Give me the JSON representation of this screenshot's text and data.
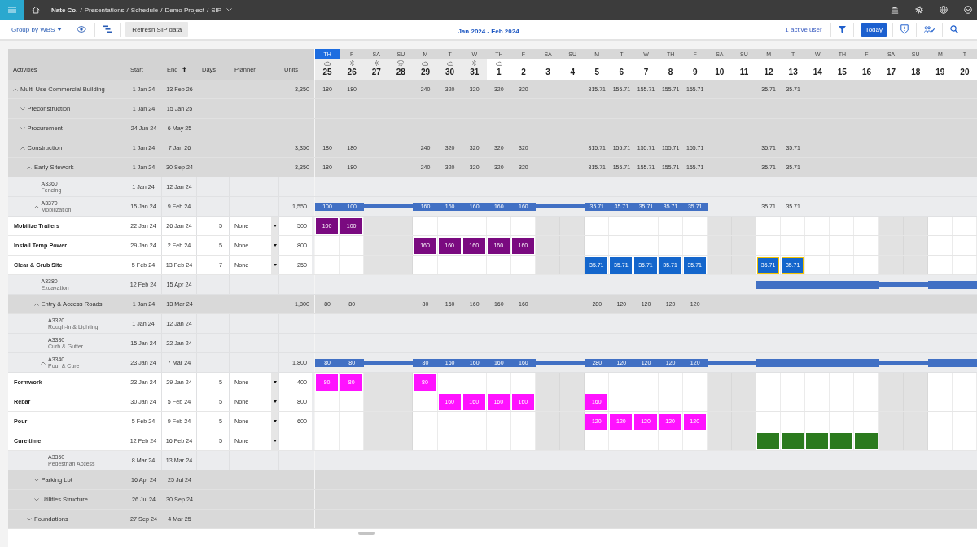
{
  "top_bar": {
    "breadcrumb": [
      "Nate Co.",
      "Presentations",
      "Schedule",
      "Demo Project",
      "SIP"
    ],
    "separator": "/"
  },
  "toolbar": {
    "group_by": "Group by WBS",
    "refresh_button": "Refresh SIP data",
    "date_range": "Jan 2024 - Feb 2024",
    "active_users": "1 active user",
    "today_button": "Today"
  },
  "table": {
    "columns": [
      {
        "label": "Activities",
        "sorted": false
      },
      {
        "label": "Start",
        "sorted": false
      },
      {
        "label": "End",
        "sorted": true
      },
      {
        "label": "Days",
        "sorted": false
      },
      {
        "label": "Planner",
        "sorted": false
      },
      {
        "label": "Units",
        "sorted": false
      }
    ]
  },
  "timeline": {
    "days": [
      {
        "weekday": "TH",
        "date": "25",
        "today": true,
        "weekend": false,
        "shaded": true,
        "weather": {
          "kind": "cloud"
        }
      },
      {
        "weekday": "F",
        "date": "26",
        "today": false,
        "weekend": false,
        "shaded": true,
        "weather": {
          "kind": "sun"
        }
      },
      {
        "weekday": "SA",
        "date": "27",
        "today": false,
        "weekend": true,
        "shaded": true,
        "weather": {
          "kind": "sun"
        }
      },
      {
        "weekday": "SU",
        "date": "28",
        "today": false,
        "weekend": true,
        "shaded": true,
        "weather": {
          "kind": "rain"
        }
      },
      {
        "weekday": "M",
        "date": "29",
        "today": false,
        "weekend": false,
        "shaded": true,
        "weather": {
          "kind": "cloud"
        }
      },
      {
        "weekday": "T",
        "date": "30",
        "today": false,
        "weekend": false,
        "shaded": true,
        "weather": {
          "kind": "cloud"
        }
      },
      {
        "weekday": "W",
        "date": "31",
        "today": false,
        "weekend": false,
        "shaded": true,
        "weather": {
          "kind": "sun"
        }
      },
      {
        "weekday": "TH",
        "date": "1",
        "today": false,
        "weekend": false,
        "shaded": false,
        "weather": {
          "kind": "cloud"
        }
      },
      {
        "weekday": "F",
        "date": "2",
        "today": false,
        "weekend": false,
        "shaded": false
      },
      {
        "weekday": "SA",
        "date": "3",
        "today": false,
        "weekend": true,
        "shaded": false
      },
      {
        "weekday": "SU",
        "date": "4",
        "today": false,
        "weekend": true,
        "shaded": false
      },
      {
        "weekday": "M",
        "date": "5",
        "today": false,
        "weekend": false,
        "shaded": false
      },
      {
        "weekday": "T",
        "date": "6",
        "today": false,
        "weekend": false,
        "shaded": false
      },
      {
        "weekday": "W",
        "date": "7",
        "today": false,
        "weekend": false,
        "shaded": false
      },
      {
        "weekday": "TH",
        "date": "8",
        "today": false,
        "weekend": false,
        "shaded": false
      },
      {
        "weekday": "F",
        "date": "9",
        "today": false,
        "weekend": false,
        "shaded": false
      },
      {
        "weekday": "SA",
        "date": "10",
        "today": false,
        "weekend": true,
        "shaded": false
      },
      {
        "weekday": "SU",
        "date": "11",
        "today": false,
        "weekend": true,
        "shaded": false
      },
      {
        "weekday": "M",
        "date": "12",
        "today": false,
        "weekend": false,
        "shaded": false
      },
      {
        "weekday": "T",
        "date": "13",
        "today": false,
        "weekend": false,
        "shaded": false
      },
      {
        "weekday": "W",
        "date": "14",
        "today": false,
        "weekend": false,
        "shaded": false
      },
      {
        "weekday": "TH",
        "date": "15",
        "today": false,
        "weekend": false,
        "shaded": false
      },
      {
        "weekday": "F",
        "date": "16",
        "today": false,
        "weekend": false,
        "shaded": false
      },
      {
        "weekday": "SA",
        "date": "17",
        "today": false,
        "weekend": true,
        "shaded": false
      },
      {
        "weekday": "SU",
        "date": "18",
        "today": false,
        "weekend": true,
        "shaded": false
      },
      {
        "weekday": "M",
        "date": "19",
        "today": false,
        "weekend": false,
        "shaded": false
      },
      {
        "weekday": "T",
        "date": "20",
        "today": false,
        "weekend": false,
        "shaded": false
      }
    ]
  },
  "rows": [
    {
      "kind": "wbs",
      "name": "Multi-Use Commercial Building",
      "start": "1 Jan 24",
      "end": "13 Feb 26",
      "units": "3,350",
      "expanded": true,
      "cells": [
        "180",
        "180",
        null,
        null,
        "240",
        "320",
        "320",
        "320",
        "320",
        null,
        null,
        "315.71",
        "155.71",
        "155.71",
        "155.71",
        "155.71",
        null,
        null,
        "35.71",
        "35.71",
        null,
        null,
        null,
        null,
        null,
        null,
        null
      ],
      "children": [
        {
          "kind": "wbs",
          "name": "Preconstruction",
          "start": "1 Jan 24",
          "end": "15 Jan 25",
          "expanded": false
        },
        {
          "kind": "wbs",
          "name": "Procurement",
          "start": "24 Jun 24",
          "end": "6 May 25",
          "expanded": false
        },
        {
          "kind": "wbs",
          "name": "Construction",
          "start": "1 Jan 24",
          "end": "7 Jan 26",
          "units": "3,350",
          "expanded": true,
          "cells": [
            "180",
            "180",
            null,
            null,
            "240",
            "320",
            "320",
            "320",
            "320",
            null,
            null,
            "315.71",
            "155.71",
            "155.71",
            "155.71",
            "155.71",
            null,
            null,
            "35.71",
            "35.71",
            null,
            null,
            null,
            null,
            null,
            null,
            null
          ],
          "children": [
            {
              "kind": "wbs",
              "name": "Early Sitework",
              "start": "1 Jan 24",
              "end": "30 Sep 24",
              "units": "3,350",
              "expanded": true,
              "cells": [
                "180",
                "180",
                null,
                null,
                "240",
                "320",
                "320",
                "320",
                "320",
                null,
                null,
                "315.71",
                "155.71",
                "155.71",
                "155.71",
                "155.71",
                null,
                null,
                "35.71",
                "35.71",
                null,
                null,
                null,
                null,
                null,
                null,
                null
              ],
              "children": [
                {
                  "kind": "activity",
                  "id": "A3360",
                  "name": "Fencing",
                  "start": "1 Jan 24",
                  "end": "12 Jan 24"
                },
                {
                  "kind": "activity",
                  "id": "A3370",
                  "name": "Mobilization",
                  "start": "15 Jan 24",
                  "end": "9 Feb 24",
                  "units": "1,550",
                  "expanded": true,
                  "cells": [
                    {
                      "kind": "bar",
                      "value": "100"
                    },
                    {
                      "kind": "bar",
                      "value": "100"
                    },
                    {
                      "kind": "bar"
                    },
                    {
                      "kind": "bar"
                    },
                    {
                      "kind": "bar",
                      "value": "160"
                    },
                    {
                      "kind": "bar",
                      "value": "160"
                    },
                    {
                      "kind": "bar",
                      "value": "160"
                    },
                    {
                      "kind": "bar",
                      "value": "160"
                    },
                    {
                      "kind": "bar",
                      "value": "160"
                    },
                    {
                      "kind": "bar"
                    },
                    {
                      "kind": "bar"
                    },
                    {
                      "kind": "bar",
                      "value": "35.71"
                    },
                    {
                      "kind": "bar",
                      "value": "35.71"
                    },
                    {
                      "kind": "bar",
                      "value": "35.71"
                    },
                    {
                      "kind": "bar",
                      "value": "35.71"
                    },
                    {
                      "kind": "bar",
                      "value": "35.71"
                    },
                    null,
                    null,
                    "35.71",
                    "35.71",
                    null,
                    null,
                    null,
                    null,
                    null,
                    null,
                    null
                  ],
                  "children": [
                    {
                      "kind": "task",
                      "name": "Mobilize Trailers",
                      "start": "22 Jan 24",
                      "end": "26 Jan 24",
                      "days": "5",
                      "planner": "None",
                      "units": "500",
                      "color": "#7a0a80",
                      "cells": [
                        {
                          "kind": "block",
                          "value": "100",
                          "highlighted": false
                        },
                        {
                          "kind": "block",
                          "value": "100",
                          "highlighted": false
                        },
                        null,
                        null,
                        null,
                        null,
                        null,
                        null,
                        null,
                        null,
                        null,
                        null,
                        null,
                        null,
                        null,
                        null,
                        null,
                        null,
                        null,
                        null,
                        null,
                        null,
                        null,
                        null,
                        null,
                        null,
                        null
                      ]
                    },
                    {
                      "kind": "task",
                      "name": "Install Temp Power",
                      "start": "29 Jan 24",
                      "end": "2 Feb 24",
                      "days": "5",
                      "planner": "None",
                      "units": "800",
                      "color": "#7a0a80",
                      "cells": [
                        null,
                        null,
                        null,
                        null,
                        {
                          "kind": "block",
                          "value": "160",
                          "highlighted": false
                        },
                        {
                          "kind": "block",
                          "value": "160",
                          "highlighted": false
                        },
                        {
                          "kind": "block",
                          "value": "160",
                          "highlighted": false
                        },
                        {
                          "kind": "block",
                          "value": "160",
                          "highlighted": false
                        },
                        {
                          "kind": "block",
                          "value": "160",
                          "highlighted": false
                        },
                        null,
                        null,
                        null,
                        null,
                        null,
                        null,
                        null,
                        null,
                        null,
                        null,
                        null,
                        null,
                        null,
                        null,
                        null,
                        null,
                        null,
                        null
                      ]
                    },
                    {
                      "kind": "task",
                      "name": "Clear & Grub Site",
                      "start": "5 Feb 24",
                      "end": "13 Feb 24",
                      "days": "7",
                      "planner": "None",
                      "units": "250",
                      "color": "#1466cc",
                      "cells": [
                        null,
                        null,
                        null,
                        null,
                        null,
                        null,
                        null,
                        null,
                        null,
                        null,
                        null,
                        {
                          "kind": "block",
                          "value": "35.71",
                          "highlighted": false
                        },
                        {
                          "kind": "block",
                          "value": "35.71",
                          "highlighted": false
                        },
                        {
                          "kind": "block",
                          "value": "35.71",
                          "highlighted": false
                        },
                        {
                          "kind": "block",
                          "value": "35.71",
                          "highlighted": false
                        },
                        {
                          "kind": "block",
                          "value": "35.71",
                          "highlighted": false
                        },
                        null,
                        null,
                        {
                          "kind": "block",
                          "value": "35.71",
                          "highlighted": true
                        },
                        {
                          "kind": "block",
                          "value": "35.71",
                          "highlighted": true
                        },
                        null,
                        null,
                        null,
                        null,
                        null,
                        null,
                        null
                      ]
                    }
                  ]
                },
                {
                  "kind": "activity",
                  "id": "A3380",
                  "name": "Excavation",
                  "start": "12 Feb 24",
                  "end": "15 Apr 24",
                  "cells": [
                    null,
                    null,
                    null,
                    null,
                    null,
                    null,
                    null,
                    null,
                    null,
                    null,
                    null,
                    null,
                    null,
                    null,
                    null,
                    null,
                    null,
                    null,
                    {
                      "kind": "bar"
                    },
                    {
                      "kind": "bar"
                    },
                    {
                      "kind": "bar"
                    },
                    {
                      "kind": "bar"
                    },
                    {
                      "kind": "bar"
                    },
                    {
                      "kind": "bar"
                    },
                    {
                      "kind": "bar"
                    },
                    {
                      "kind": "bar"
                    },
                    {
                      "kind": "bar"
                    }
                  ]
                },
                {
                  "kind": "wbs",
                  "name": "Entry & Access Roads",
                  "start": "1 Jan 24",
                  "end": "13 Mar 24",
                  "units": "1,800",
                  "expanded": true,
                  "cells": [
                    "80",
                    "80",
                    null,
                    null,
                    "80",
                    "160",
                    "160",
                    "160",
                    "160",
                    null,
                    null,
                    "280",
                    "120",
                    "120",
                    "120",
                    "120",
                    null,
                    null,
                    null,
                    null,
                    null,
                    null,
                    null,
                    null,
                    null,
                    null,
                    null
                  ],
                  "children": [
                    {
                      "kind": "activity",
                      "id": "A3320",
                      "name": "Rough-in & Lighting",
                      "start": "1 Jan 24",
                      "end": "12 Jan 24"
                    },
                    {
                      "kind": "activity",
                      "id": "A3330",
                      "name": "Curb & Gutter",
                      "start": "15 Jan 24",
                      "end": "22 Jan 24"
                    },
                    {
                      "kind": "activity",
                      "id": "A3340",
                      "name": "Pour & Cure",
                      "start": "23 Jan 24",
                      "end": "7 Mar 24",
                      "units": "1,800",
                      "expanded": true,
                      "cells": [
                        {
                          "kind": "bar",
                          "value": "80"
                        },
                        {
                          "kind": "bar",
                          "value": "80"
                        },
                        {
                          "kind": "bar"
                        },
                        {
                          "kind": "bar"
                        },
                        {
                          "kind": "bar",
                          "value": "80"
                        },
                        {
                          "kind": "bar",
                          "value": "160"
                        },
                        {
                          "kind": "bar",
                          "value": "160"
                        },
                        {
                          "kind": "bar",
                          "value": "160"
                        },
                        {
                          "kind": "bar",
                          "value": "160"
                        },
                        {
                          "kind": "bar"
                        },
                        {
                          "kind": "bar"
                        },
                        {
                          "kind": "bar",
                          "value": "280"
                        },
                        {
                          "kind": "bar",
                          "value": "120"
                        },
                        {
                          "kind": "bar",
                          "value": "120"
                        },
                        {
                          "kind": "bar",
                          "value": "120"
                        },
                        {
                          "kind": "bar",
                          "value": "120"
                        },
                        {
                          "kind": "bar"
                        },
                        {
                          "kind": "bar"
                        },
                        {
                          "kind": "bar"
                        },
                        {
                          "kind": "bar"
                        },
                        {
                          "kind": "bar"
                        },
                        {
                          "kind": "bar"
                        },
                        {
                          "kind": "bar"
                        },
                        {
                          "kind": "bar"
                        },
                        {
                          "kind": "bar"
                        },
                        {
                          "kind": "bar"
                        },
                        {
                          "kind": "bar"
                        }
                      ],
                      "children": [
                        {
                          "kind": "task",
                          "name": "Formwork",
                          "start": "23 Jan 24",
                          "end": "29 Jan 24",
                          "days": "5",
                          "planner": "None",
                          "units": "400",
                          "color": "#ff12ff",
                          "cells": [
                            {
                              "kind": "block",
                              "value": "80",
                              "highlighted": false
                            },
                            {
                              "kind": "block",
                              "value": "80",
                              "highlighted": false
                            },
                            null,
                            null,
                            {
                              "kind": "block",
                              "value": "80",
                              "highlighted": false
                            },
                            null,
                            null,
                            null,
                            null,
                            null,
                            null,
                            null,
                            null,
                            null,
                            null,
                            null,
                            null,
                            null,
                            null,
                            null,
                            null,
                            null,
                            null,
                            null,
                            null,
                            null,
                            null
                          ]
                        },
                        {
                          "kind": "task",
                          "name": "Rebar",
                          "start": "30 Jan 24",
                          "end": "5 Feb 24",
                          "days": "5",
                          "planner": "None",
                          "units": "800",
                          "color": "#ff12ff",
                          "cells": [
                            null,
                            null,
                            null,
                            null,
                            null,
                            {
                              "kind": "block",
                              "value": "160",
                              "highlighted": false
                            },
                            {
                              "kind": "block",
                              "value": "160",
                              "highlighted": false
                            },
                            {
                              "kind": "block",
                              "value": "160",
                              "highlighted": false
                            },
                            {
                              "kind": "block",
                              "value": "160",
                              "highlighted": false
                            },
                            null,
                            null,
                            {
                              "kind": "block",
                              "value": "160",
                              "highlighted": false
                            },
                            null,
                            null,
                            null,
                            null,
                            null,
                            null,
                            null,
                            null,
                            null,
                            null,
                            null,
                            null,
                            null,
                            null,
                            null
                          ]
                        },
                        {
                          "kind": "task",
                          "name": "Pour",
                          "start": "5 Feb 24",
                          "end": "9 Feb 24",
                          "days": "5",
                          "planner": "None",
                          "units": "600",
                          "color": "#ff12ff",
                          "cells": [
                            null,
                            null,
                            null,
                            null,
                            null,
                            null,
                            null,
                            null,
                            null,
                            null,
                            null,
                            {
                              "kind": "block",
                              "value": "120",
                              "highlighted": false
                            },
                            {
                              "kind": "block",
                              "value": "120",
                              "highlighted": false
                            },
                            {
                              "kind": "block",
                              "value": "120",
                              "highlighted": false
                            },
                            {
                              "kind": "block",
                              "value": "120",
                              "highlighted": false
                            },
                            {
                              "kind": "block",
                              "value": "120",
                              "highlighted": false
                            },
                            null,
                            null,
                            null,
                            null,
                            null,
                            null,
                            null,
                            null,
                            null,
                            null,
                            null
                          ]
                        },
                        {
                          "kind": "task",
                          "name": "Cure time",
                          "start": "12 Feb 24",
                          "end": "16 Feb 24",
                          "days": "5",
                          "planner": "None",
                          "color": "#2b7a1e",
                          "cells": [
                            null,
                            null,
                            null,
                            null,
                            null,
                            null,
                            null,
                            null,
                            null,
                            null,
                            null,
                            null,
                            null,
                            null,
                            null,
                            null,
                            null,
                            null,
                            {
                              "kind": "block",
                              "highlighted": false
                            },
                            {
                              "kind": "block",
                              "highlighted": false
                            },
                            {
                              "kind": "block",
                              "highlighted": false
                            },
                            {
                              "kind": "block",
                              "highlighted": false
                            },
                            {
                              "kind": "block",
                              "highlighted": false
                            },
                            null,
                            null,
                            null,
                            null
                          ]
                        }
                      ]
                    },
                    {
                      "kind": "activity",
                      "id": "A3350",
                      "name": "Pedestrian Access",
                      "start": "8 Mar 24",
                      "end": "13 Mar 24"
                    }
                  ]
                },
                {
                  "kind": "wbs",
                  "name": "Parking Lot",
                  "start": "16 Apr 24",
                  "end": "25 Jul 24",
                  "expanded": false
                },
                {
                  "kind": "wbs",
                  "name": "Utilities Structure",
                  "start": "26 Jul 24",
                  "end": "30 Sep 24",
                  "expanded": false
                }
              ]
            },
            {
              "kind": "wbs",
              "name": "Foundations",
              "start": "27 Sep 24",
              "end": "4 Mar 25",
              "expanded": false
            }
          ]
        }
      ]
    }
  ]
}
